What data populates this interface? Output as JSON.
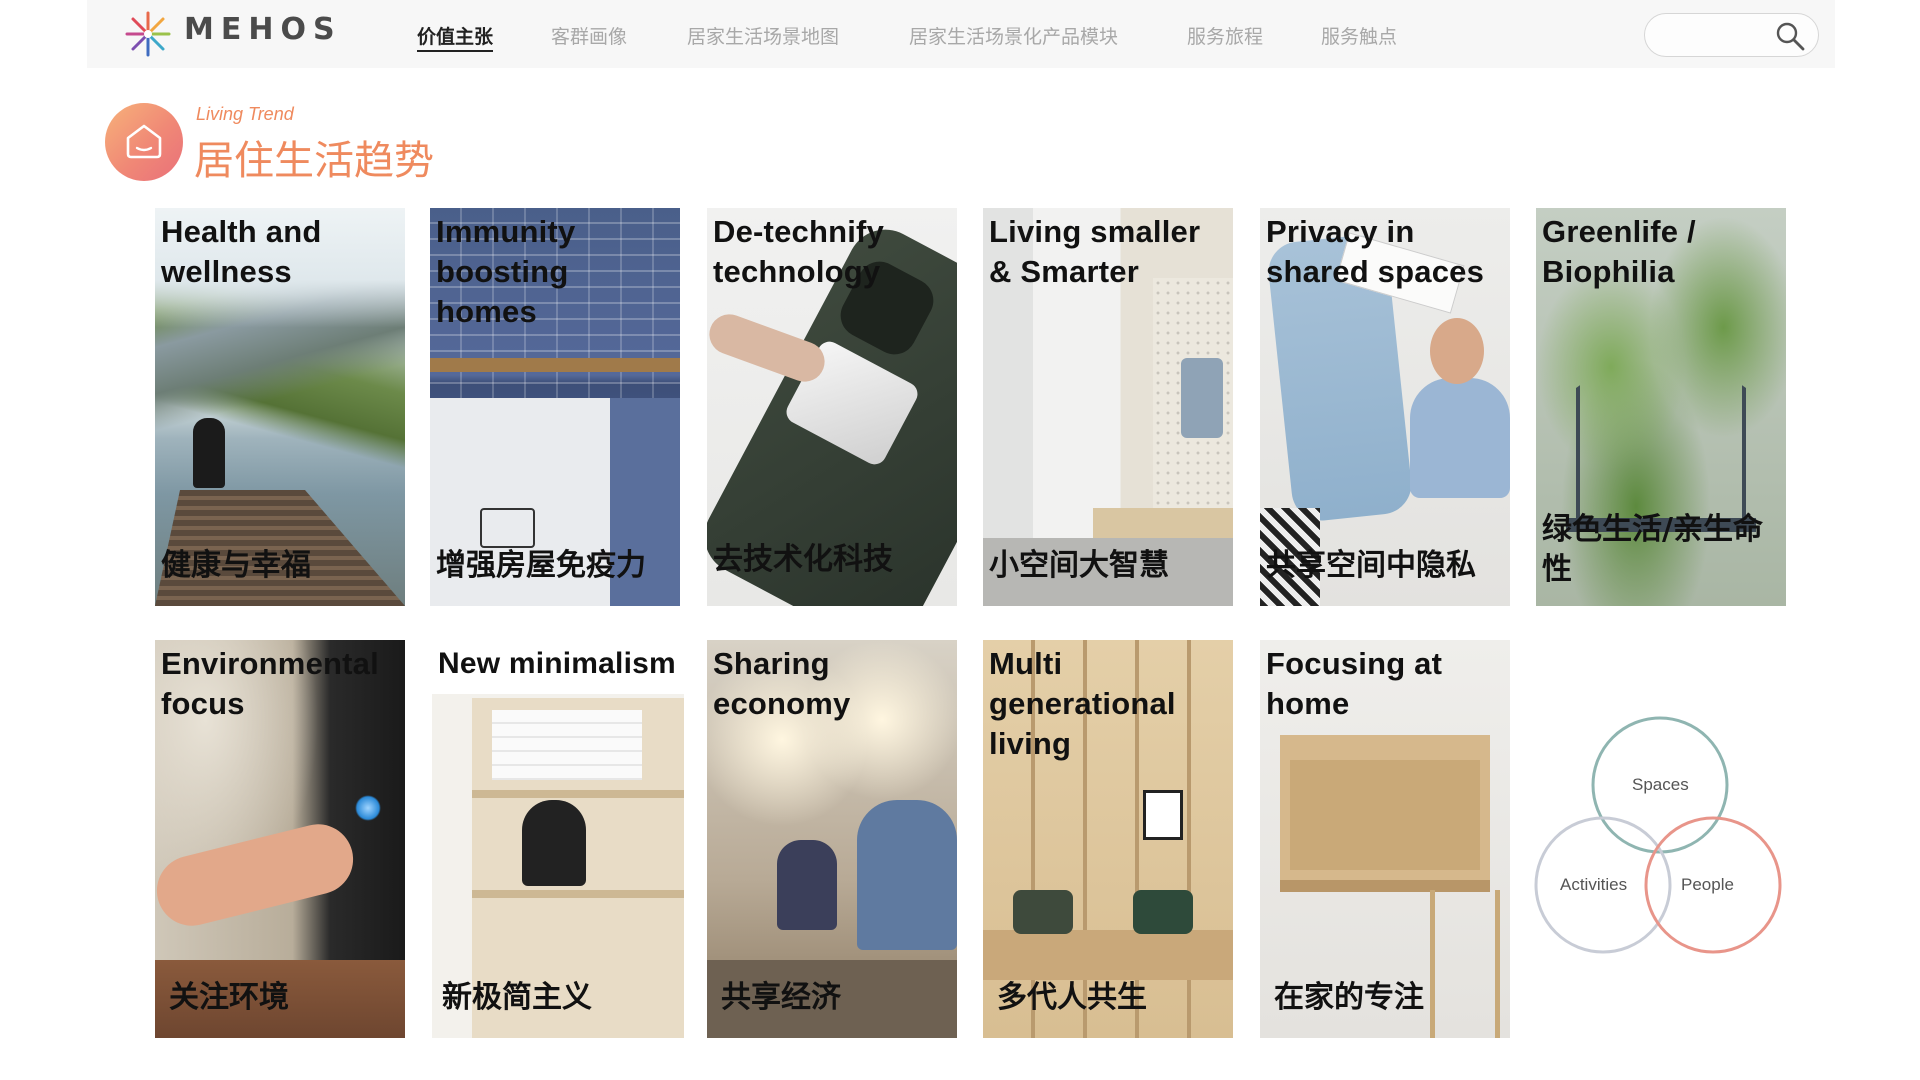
{
  "header": {
    "brand": "MEHOS",
    "nav": [
      {
        "label": "价值主张",
        "active": true
      },
      {
        "label": "客群画像",
        "active": false
      },
      {
        "label": "居家生活场景地图",
        "active": false
      },
      {
        "label": "居家生活场景化产品模块",
        "active": false
      },
      {
        "label": "服务旅程",
        "active": false
      },
      {
        "label": "服务触点",
        "active": false
      }
    ],
    "search": {
      "placeholder": "",
      "icon": "search-icon"
    }
  },
  "section": {
    "subtitle": "Living Trend",
    "title": "居住生活趋势",
    "icon": "house-icon"
  },
  "cards": [
    {
      "en": "Health and\nwellness",
      "zh": "健康与幸福",
      "scene": "lake-mountains"
    },
    {
      "en": "Immunity\nboosting\nhomes",
      "zh": "增强房屋免疫力",
      "scene": "kitchen-sink"
    },
    {
      "en": "De-technify\ntechnology",
      "zh": "去技术化科技",
      "scene": "phone"
    },
    {
      "en": "Living smaller\n& Smarter",
      "zh": "小空间大智慧",
      "scene": "small-room"
    },
    {
      "en": "Privacy in\nshared spaces",
      "zh": "共享空间中隐私",
      "scene": "person-reading"
    },
    {
      "en": "Greenlife /\nBiophilia",
      "zh": "绿色生活/亲生命性",
      "scene": "plants"
    },
    {
      "en": "Environmental\nfocus",
      "zh": "关注环境",
      "scene": "touch-screen"
    },
    {
      "en": "New minimalism",
      "zh": "新极简主义",
      "scene": "shelf-mirror"
    },
    {
      "en": "Sharing\neconomy",
      "zh": "共享经济",
      "scene": "coworking"
    },
    {
      "en": "Multi\ngenerational\nliving",
      "zh": "多代人共生",
      "scene": "wood-room"
    },
    {
      "en": "Focusing at\nhome",
      "zh": "在家的专注",
      "scene": "wall-desk"
    }
  ],
  "venn": {
    "labels": [
      "Spaces",
      "Activities",
      "People"
    ],
    "colors": {
      "spaces": "#8fb5b1",
      "activities": "#c8ccd6",
      "people": "#e8958a"
    }
  }
}
